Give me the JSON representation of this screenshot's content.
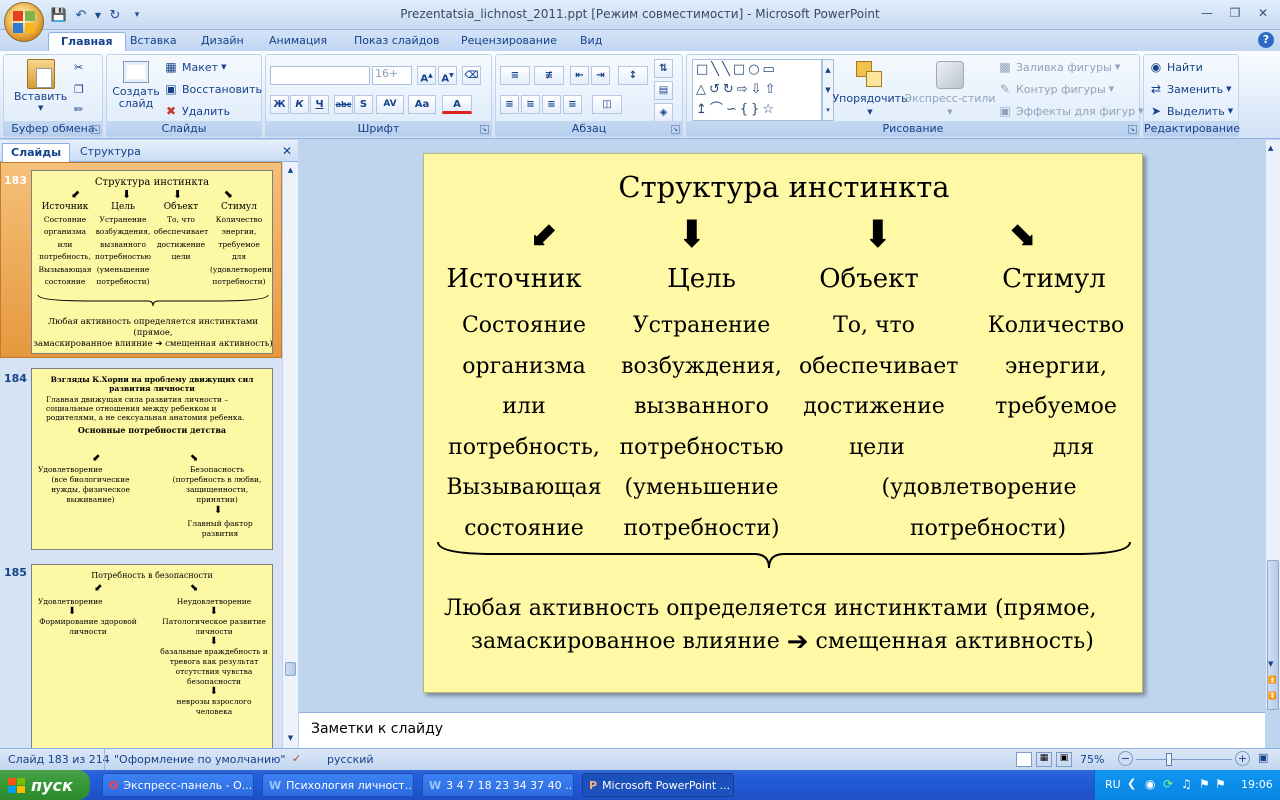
{
  "window": {
    "title": "Prezentatsia_lichnost_2011.ppt [Режим совместимости] - Microsoft PowerPoint",
    "help": "?"
  },
  "qat": {
    "save_icon": "save-icon",
    "undo_icon": "undo-icon",
    "redo_icon": "redo-icon",
    "customize_icon": "chevron-down-icon"
  },
  "tabs": [
    "Главная",
    "Вставка",
    "Дизайн",
    "Анимация",
    "Показ слайдов",
    "Рецензирование",
    "Вид"
  ],
  "ribbon": {
    "clipboard": {
      "label": "Буфер обмена",
      "paste": "Вставить"
    },
    "slides": {
      "label": "Слайды",
      "new_slide": "Создать слайд",
      "layout": "Макет",
      "reset": "Восстановить",
      "delete": "Удалить"
    },
    "font": {
      "label": "Шрифт",
      "font_name": "",
      "font_size": "16+",
      "bold": "Ж",
      "italic": "К",
      "underline": "Ч",
      "strike": "abc",
      "shadow": "S",
      "spacing": "AV",
      "case": "Aa",
      "color": "A"
    },
    "paragraph": {
      "label": "Абзац"
    },
    "drawing": {
      "label": "Рисование",
      "arrange": "Упорядочить",
      "quick_styles": "Экспресс-стили",
      "fill": "Заливка фигуры",
      "outline": "Контур фигуры",
      "effects": "Эффекты для фигур"
    },
    "editing": {
      "label": "Редактирование",
      "find": "Найти",
      "replace": "Заменить",
      "select": "Выделить"
    }
  },
  "left_pane": {
    "tabs": [
      "Слайды",
      "Структура"
    ],
    "slides": [
      {
        "number": "183",
        "title": "Структура инстинкта",
        "columns": [
          {
            "head": "Источник",
            "text": "Состояние организма или потребность, Вызывающая состояние"
          },
          {
            "head": "Цель",
            "text": "Устранение возбуждения, вызванного потребностью (уменьшение потребности)"
          },
          {
            "head": "Объект",
            "text": "То, что обеспечивает достижение цели"
          },
          {
            "head": "Стимул",
            "text": "Количество энергии, требуемое для (удовлетворение потребности)"
          }
        ],
        "footer_1": "Любая активность определяется инстинктами (прямое,",
        "footer_2a": "замаскированное влияние",
        "footer_2b": "смещенная активность)"
      },
      {
        "number": "184",
        "title": "Взгляды К.Хорни на проблему движущих сил развития личности",
        "intro": "Главная движущая сила развития личности – социальные отношения между ребенком и родителями, а не сексуальная анатомия ребенка.",
        "subtitle": "Основные потребности детства",
        "left_head": "Удовлетворение",
        "left_text": "(все биологические нужды, физическое выживание)",
        "right_head": "Безопасность",
        "right_text": "(потребность в любви, защищенности, принятии)",
        "bottom": "Главный фактор развития"
      },
      {
        "number": "185",
        "title": "Потребность в безопасности",
        "left_head": "Удовлетворение",
        "left_text": "Формирование здоровой личности",
        "right_head": "Неудовлетворение",
        "right_1": "Патологическое развитие личности",
        "right_2": "базальные враждебность и тревога как результат отсутствия чувства безопасности",
        "right_3": "неврозы взрослого человека"
      }
    ]
  },
  "slide": {
    "title": "Структура инстинкта",
    "columns": [
      {
        "head": "Источник",
        "lines": [
          "Состояние",
          "организма",
          "или",
          "потребность,",
          "Вызывающая",
          "состояние"
        ]
      },
      {
        "head": "Цель",
        "lines": [
          "Устранение",
          "возбуждения,",
          "вызванного",
          "потребностью",
          "(уменьшение",
          "потребности)"
        ]
      },
      {
        "head": "Объект",
        "lines": [
          "То, что",
          "обеспечивает",
          "достижение",
          "цели"
        ]
      },
      {
        "head": "Стимул",
        "lines": [
          "Количество",
          "энергии,",
          "требуемое",
          "для"
        ]
      }
    ],
    "shared_lines": [
      "(удовлетворение",
      "потребности)"
    ],
    "footer_1": "Любая активность определяется инстинктами (прямое,",
    "footer_2a": "замаскированное влияние",
    "footer_2b": "смещенная активность)"
  },
  "notes": {
    "placeholder": "Заметки к слайду"
  },
  "status": {
    "slide_info": "Слайд 183 из 214",
    "theme": "\"Оформление по умолчанию\"",
    "language": "русский",
    "zoom": "75%"
  },
  "taskbar": {
    "start": "пуск",
    "tasks": [
      "Экспресс-панель - О...",
      "Психология личност...",
      "3 4 7 18 23 34 37 40 ...",
      "Microsoft PowerPoint ..."
    ],
    "lang": "RU",
    "clock": "19:06"
  },
  "colors": {
    "slide_bg": "#fff9a6",
    "ribbon_text": "#15428b",
    "taskbar": "#245edb",
    "selection": "#e7983e"
  }
}
